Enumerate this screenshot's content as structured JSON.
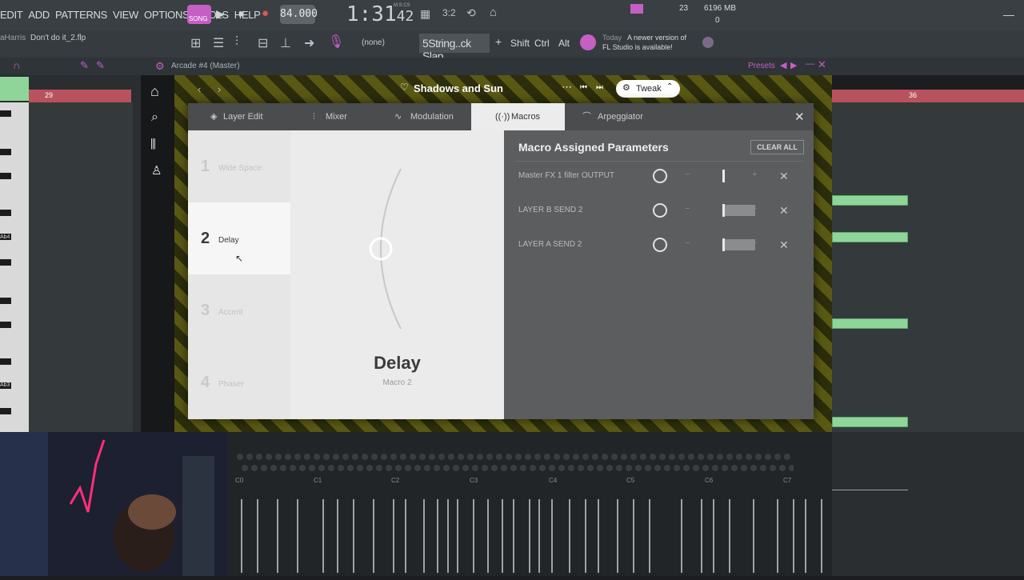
{
  "menu": [
    "EDIT",
    "ADD",
    "PATTERNS",
    "VIEW",
    "OPTIONS",
    "TOOLS",
    "HELP"
  ],
  "transport": {
    "song_mode": "SONG",
    "tempo": "84.000",
    "time": "1:31",
    "time_small": "42",
    "time_unit": "M:S:CS",
    "cpu": "23",
    "memory": "6196 MB",
    "voices": "0"
  },
  "project": {
    "title": "Don't do it_2.flp",
    "user": "aHarris"
  },
  "toolbar": {
    "channel_none": "(none)",
    "preset_name": "5String..ck Slap",
    "shift": "Shift",
    "ctrl": "Ctrl",
    "alt": "Alt",
    "notice_day": "Today",
    "notice_text_1": "A newer version of",
    "notice_text_2": "FL Studio is available!"
  },
  "plugin_window": {
    "title": "Arcade #4 (Master)",
    "presets": "Presets"
  },
  "ruler": {
    "left_bar": "29",
    "right_bar": "36"
  },
  "arcade": {
    "kit_name": "Shadows and Sun",
    "tweak": "Tweak",
    "tabs": [
      {
        "label": "Layer Edit",
        "icon": "layers-icon"
      },
      {
        "label": "Mixer",
        "icon": "mixer-icon"
      },
      {
        "label": "Modulation",
        "icon": "modulation-icon"
      },
      {
        "label": "Macros",
        "icon": "macros-icon"
      },
      {
        "label": "Arpeggiator",
        "icon": "arpeggiator-icon"
      }
    ],
    "active_tab": "Macros",
    "macros": [
      {
        "num": "1",
        "label": "Wide Space"
      },
      {
        "num": "2",
        "label": "Delay"
      },
      {
        "num": "3",
        "label": "Accent"
      },
      {
        "num": "4",
        "label": "Phaser"
      }
    ],
    "selected_macro": {
      "name": "Delay",
      "sub": "Macro 2",
      "value": 0.5
    },
    "assigned": {
      "heading": "Macro Assigned Parameters",
      "clear_all": "CLEAR ALL",
      "params": [
        {
          "name": "Master FX 1 filter OUTPUT",
          "range_from": 0.5,
          "range_to": 0.5
        },
        {
          "name": "LAYER B SEND 2",
          "range_from": 0.5,
          "range_to": 0.9
        },
        {
          "name": "LAYER A SEND 2",
          "range_from": 0.5,
          "range_to": 0.9
        }
      ]
    }
  },
  "piano_labels": {
    "ab4": "Ab4",
    "ab3": "Ab3"
  },
  "keyboard_labels": [
    "C0",
    "C1",
    "C2",
    "C3",
    "C4",
    "C5",
    "C6",
    "C7"
  ]
}
